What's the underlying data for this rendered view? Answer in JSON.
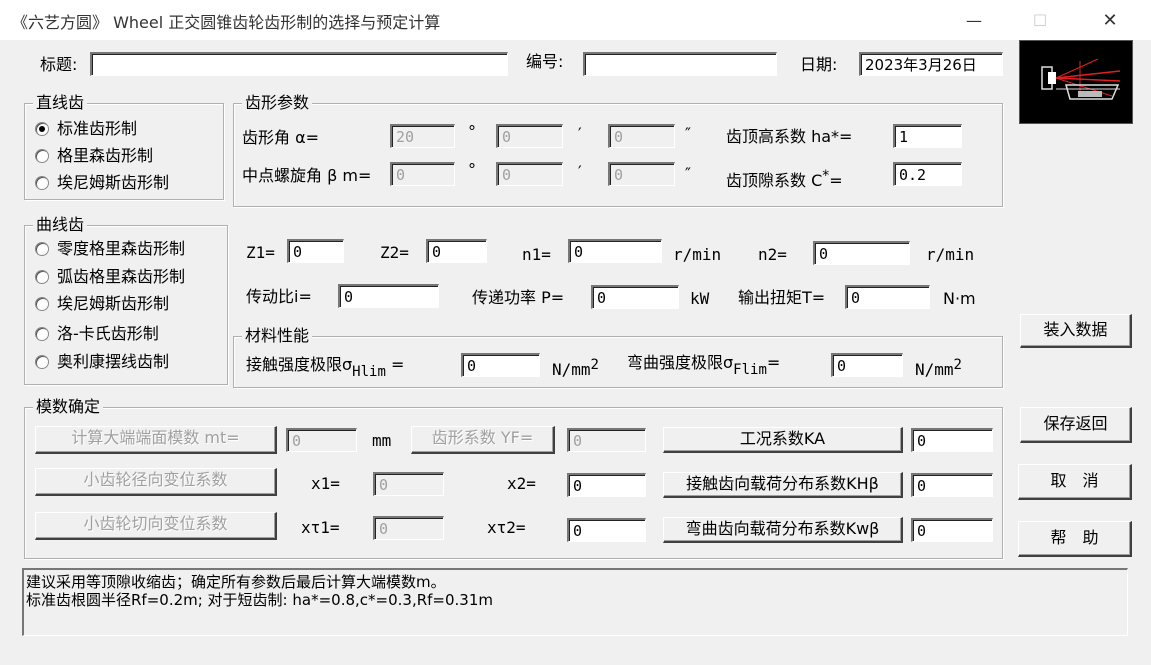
{
  "window": {
    "title": "《六艺方圆》 Wheel 正交圆锥齿轮齿形制的选择与预定计算",
    "minimize_glyph": "—",
    "maximize_glyph": "☐",
    "close_glyph": "✕"
  },
  "header": {
    "title_label": "标题:",
    "title_value": "",
    "number_label": "编号:",
    "number_value": "",
    "date_label": "日期:",
    "date_value": "2023年3月26日"
  },
  "straight_group": {
    "title": "直线齿",
    "options": [
      {
        "label": "标准齿形制",
        "checked": true
      },
      {
        "label": "格里森齿形制",
        "checked": false
      },
      {
        "label": "埃尼姆斯齿形制",
        "checked": false
      }
    ]
  },
  "curved_group": {
    "title": "曲线齿",
    "options": [
      {
        "label": "零度格里森齿形制",
        "checked": false
      },
      {
        "label": "弧齿格里森齿形制",
        "checked": false
      },
      {
        "label": "埃尼姆斯齿形制",
        "checked": false
      },
      {
        "label": "洛-卡氏齿形制",
        "checked": false
      },
      {
        "label": "奥利康摆线齿制",
        "checked": false
      }
    ]
  },
  "tooth_params": {
    "title": "齿形参数",
    "pressure_angle_label": "齿形角  α=",
    "pressure_angle": [
      "20",
      "0",
      "0"
    ],
    "spiral_angle_label": "中点螺旋角 β m=",
    "spiral_angle": [
      "0",
      "0",
      "0"
    ],
    "deg_symbol": "°",
    "min_symbol": "′",
    "sec_symbol": "″",
    "addendum_label": "齿顶高系数 ha*=",
    "addendum_value": "1",
    "clearance_label": "齿顶隙系数 C",
    "clearance_star": "*",
    "clearance_eq": "=",
    "clearance_value": "0.2"
  },
  "gear_params": {
    "z1_label": "Z1=",
    "z1": "0",
    "z2_label": "Z2=",
    "z2": "0",
    "n1_label": "n1=",
    "n1": "0",
    "n1_unit": "r/min",
    "n2_label": "n2=",
    "n2": "0",
    "n2_unit": "r/min",
    "ratio_label": "传动比i=",
    "ratio": "0",
    "power_label": "传递功率 P=",
    "power": "0",
    "power_unit": "kW",
    "torque_label": "输出扭矩T=",
    "torque": "0",
    "torque_unit": "N·m"
  },
  "material": {
    "title": "材料性能",
    "contact_label": "接触强度极限σ",
    "contact_sub": "Hlim",
    "contact_eq": "=",
    "contact_value": "0",
    "unit": "N/mm",
    "unit_sup": "2",
    "bending_label": "弯曲强度极限σ",
    "bending_sub": "Flim",
    "bending_eq": "=",
    "bending_value": "0"
  },
  "module": {
    "title": "模数确定",
    "calc_button": "计算大端端面模数 mt=",
    "mt_value": "0",
    "mt_unit": "mm",
    "yf_button": "齿形系数 YF=",
    "yf_value": "0",
    "ka_button": "工况系数KA",
    "ka_value": "0",
    "radial_button": "小齿轮径向变位系数",
    "x1_label": "x1=",
    "x1": "0",
    "x2_label": "x2=",
    "x2": "0",
    "khb_button": "接触齿向载荷分布系数KHβ",
    "khb_value": "0",
    "tangential_button": "小齿轮切向变位系数",
    "xt1_label": "xτ1=",
    "xt1": "0",
    "xt2_label": "xτ2=",
    "xt2": "0",
    "kwb_button": "弯曲齿向载荷分布系数Kwβ",
    "kwb_value": "0"
  },
  "side_buttons": {
    "load": "装入数据",
    "save": "保存返回",
    "cancel": "取　消",
    "help": "帮　助"
  },
  "notes": [
    "建议采用等顶隙收缩齿；确定所有参数后最后计算大端模数m。",
    "标准齿根圆半径Rf=0.2m; 对于短齿制: ha*=0.8,c*=0.3,Rf=0.31m"
  ],
  "colors": {
    "dialog_bg": "#f0f0f0",
    "logo_bg": "#000000",
    "logo_red": "#e02020"
  }
}
